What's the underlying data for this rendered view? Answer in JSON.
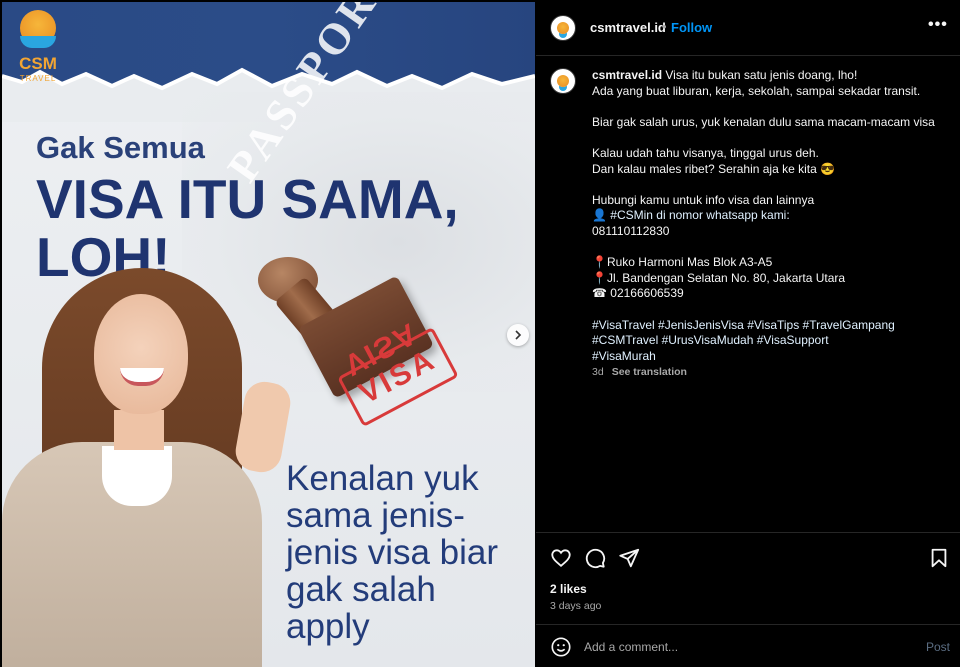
{
  "media": {
    "logo_text": "CSM",
    "logo_subtext": "TRAVEL",
    "heading_small": "Gak Semua",
    "heading_big_line1": "VISA ITU SAMA,",
    "heading_big_line2": "LOH!",
    "passport_watermark": "PASSPORT",
    "stamp_text": "VISA",
    "imprint_text": "VISA",
    "subtext_line1": "Kenalan yuk",
    "subtext_line2": "sama jenis-",
    "subtext_line3": "jenis visa biar",
    "subtext_line4": "gak salah",
    "subtext_line5": "apply",
    "next_icon": "chevron-right-icon"
  },
  "header": {
    "username": "csmtravel.id",
    "separator": "•",
    "follow_label": "Follow",
    "more_label": "•••"
  },
  "caption": {
    "username": "csmtravel.id",
    "lines": [
      "Visa itu bukan satu jenis doang, lho!",
      "Ada yang buat liburan, kerja, sekolah, sampai sekadar transit.",
      "",
      "Biar gak salah urus, yuk kenalan dulu sama macam-macam visa",
      "",
      "Kalau udah tahu visanya, tinggal urus deh.",
      "Dan kalau males ribet? Serahin aja ke kita 😎",
      "",
      "Hubungi kamu untuk info visa dan lainnya",
      "👤 #CSMin di nomor whatsapp kami:",
      "081110112830",
      "",
      "📍Ruko Harmoni Mas Blok A3-A5",
      "📍Jl. Bandengan Selatan No. 80, Jakarta Utara",
      "☎ 02166606539",
      "",
      "#VisaTravel #JenisJenisVisa #VisaTips #TravelGampang",
      "#CSMTravel #UrusVisaMudah #VisaSupport",
      "#VisaMurah"
    ],
    "age": "3d",
    "see_translation": "See translation"
  },
  "actions": {
    "like_icon": "heart-icon",
    "comment_icon": "comment-icon",
    "share_icon": "share-icon",
    "save_icon": "bookmark-icon"
  },
  "likes_text": "2 likes",
  "posted_ago": "3 days ago",
  "comment": {
    "placeholder": "Add a comment...",
    "post_label": "Post",
    "emoji_icon": "emoji-icon"
  },
  "colors": {
    "accent_blue": "#0095f6",
    "heading_navy": "#1f3470",
    "stamp_red": "#d83a3a"
  }
}
